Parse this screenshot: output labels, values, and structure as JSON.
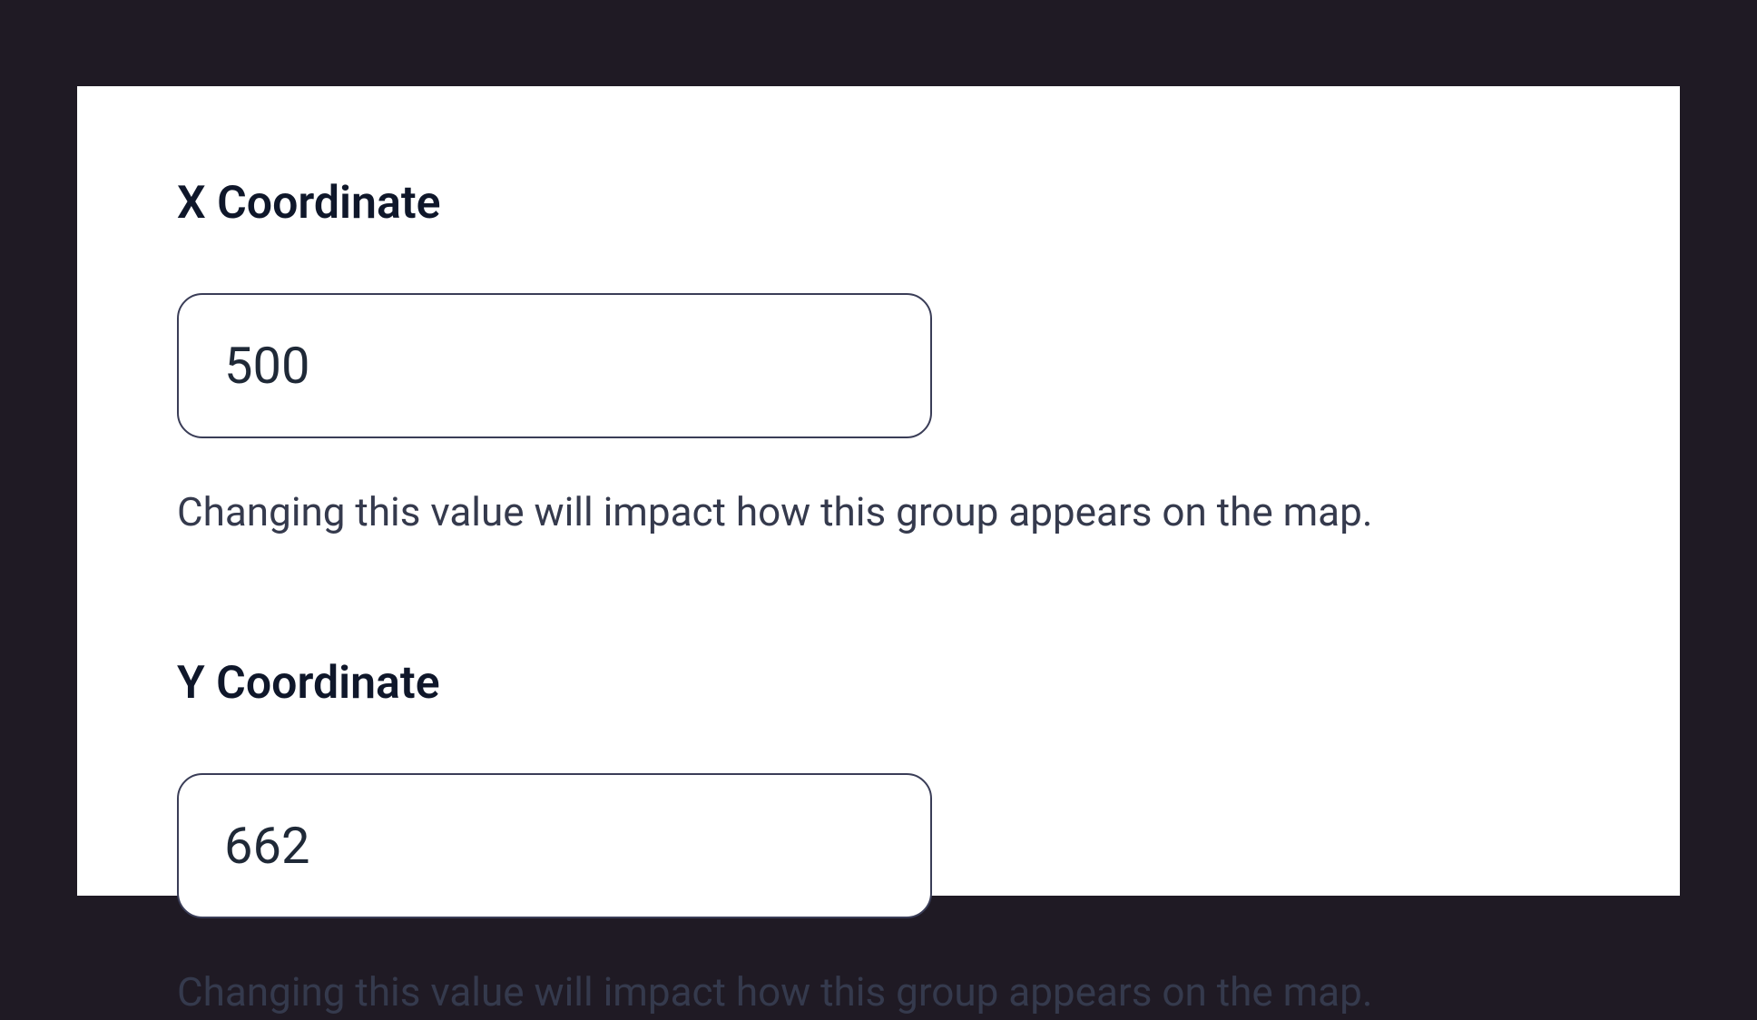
{
  "form": {
    "x_coordinate": {
      "label": "X Coordinate",
      "value": "500",
      "help": "Changing this value will impact how this group appears on the map."
    },
    "y_coordinate": {
      "label": "Y Coordinate",
      "value": "662",
      "help": "Changing this value will impact how this group appears on the map."
    }
  }
}
